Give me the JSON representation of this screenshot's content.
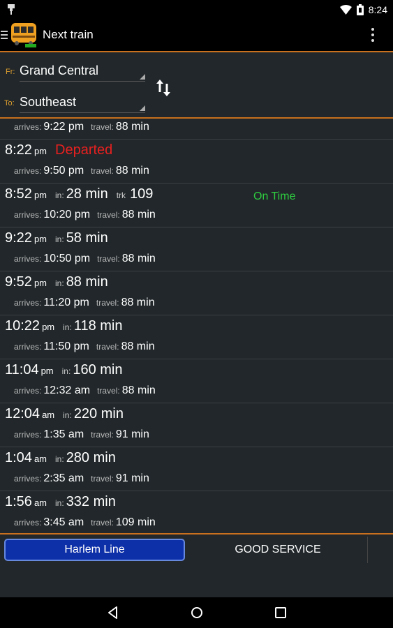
{
  "status_bar": {
    "time": "8:24",
    "icons": [
      "notification-icon",
      "wifi-icon",
      "battery-icon"
    ]
  },
  "app_bar": {
    "title": "Next train",
    "icon": "train-app-icon"
  },
  "route": {
    "from_label": "Fr:",
    "from_station": "Grand Central",
    "to_label": "To:",
    "to_station": "Southeast"
  },
  "labels": {
    "arrives": "arrives:",
    "travel": "travel:",
    "in": "in:",
    "trk": "trk"
  },
  "trains": [
    {
      "time": "",
      "ampm": "",
      "in": "",
      "track": "",
      "status": "",
      "arrives": "9:22 pm",
      "travel": "88 min",
      "partial": true
    },
    {
      "time": "8:22",
      "ampm": "pm",
      "in": "",
      "track": "",
      "status": "Departed",
      "arrives": "9:50 pm",
      "travel": "88 min"
    },
    {
      "time": "8:52",
      "ampm": "pm",
      "in": "28 min",
      "track": "109",
      "status": "On Time",
      "arrives": "10:20 pm",
      "travel": "88 min"
    },
    {
      "time": "9:22",
      "ampm": "pm",
      "in": "58 min",
      "track": "",
      "status": "",
      "arrives": "10:50 pm",
      "travel": "88 min"
    },
    {
      "time": "9:52",
      "ampm": "pm",
      "in": "88 min",
      "track": "",
      "status": "",
      "arrives": "11:20 pm",
      "travel": "88 min"
    },
    {
      "time": "10:22",
      "ampm": "pm",
      "in": "118 min",
      "track": "",
      "status": "",
      "arrives": "11:50 pm",
      "travel": "88 min"
    },
    {
      "time": "11:04",
      "ampm": "pm",
      "in": "160 min",
      "track": "",
      "status": "",
      "arrives": "12:32 am",
      "travel": "88 min"
    },
    {
      "time": "12:04",
      "ampm": "am",
      "in": "220 min",
      "track": "",
      "status": "",
      "arrives": "1:35 am",
      "travel": "91 min"
    },
    {
      "time": "1:04",
      "ampm": "am",
      "in": "280 min",
      "track": "",
      "status": "",
      "arrives": "2:35 am",
      "travel": "91 min"
    },
    {
      "time": "1:56",
      "ampm": "am",
      "in": "332 min",
      "track": "",
      "status": "",
      "arrives": "3:45 am",
      "travel": "109 min"
    }
  ],
  "footer": {
    "line_button": "Harlem Line",
    "service_status": "GOOD SERVICE"
  },
  "colors": {
    "accent": "#c8701e",
    "departed": "#e82020",
    "on_time": "#2ecc40",
    "line_button": "#0d2fa8"
  },
  "nav_bar": {
    "icons": [
      "back-icon",
      "home-icon",
      "recents-icon"
    ]
  }
}
